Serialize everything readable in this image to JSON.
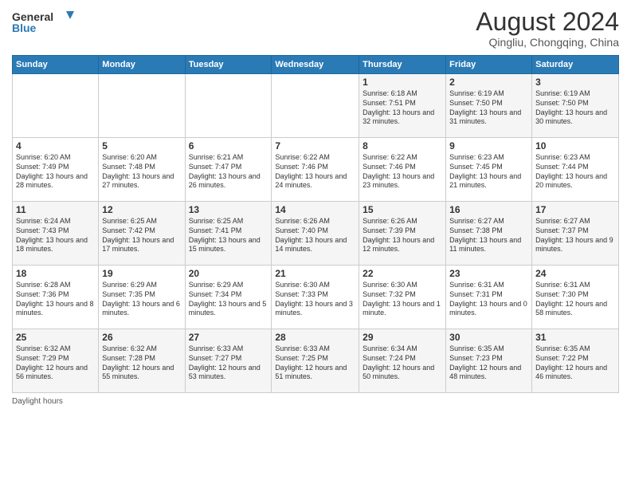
{
  "header": {
    "logo_line1": "General",
    "logo_line2": "Blue",
    "title": "August 2024",
    "subtitle": "Qingliu, Chongqing, China"
  },
  "weekdays": [
    "Sunday",
    "Monday",
    "Tuesday",
    "Wednesday",
    "Thursday",
    "Friday",
    "Saturday"
  ],
  "footer_label": "Daylight hours",
  "weeks": [
    {
      "days": [
        {
          "num": "",
          "info": ""
        },
        {
          "num": "",
          "info": ""
        },
        {
          "num": "",
          "info": ""
        },
        {
          "num": "",
          "info": ""
        },
        {
          "num": "1",
          "info": "Sunrise: 6:18 AM\nSunset: 7:51 PM\nDaylight: 13 hours and 32 minutes."
        },
        {
          "num": "2",
          "info": "Sunrise: 6:19 AM\nSunset: 7:50 PM\nDaylight: 13 hours and 31 minutes."
        },
        {
          "num": "3",
          "info": "Sunrise: 6:19 AM\nSunset: 7:50 PM\nDaylight: 13 hours and 30 minutes."
        }
      ]
    },
    {
      "days": [
        {
          "num": "4",
          "info": "Sunrise: 6:20 AM\nSunset: 7:49 PM\nDaylight: 13 hours and 28 minutes."
        },
        {
          "num": "5",
          "info": "Sunrise: 6:20 AM\nSunset: 7:48 PM\nDaylight: 13 hours and 27 minutes."
        },
        {
          "num": "6",
          "info": "Sunrise: 6:21 AM\nSunset: 7:47 PM\nDaylight: 13 hours and 26 minutes."
        },
        {
          "num": "7",
          "info": "Sunrise: 6:22 AM\nSunset: 7:46 PM\nDaylight: 13 hours and 24 minutes."
        },
        {
          "num": "8",
          "info": "Sunrise: 6:22 AM\nSunset: 7:46 PM\nDaylight: 13 hours and 23 minutes."
        },
        {
          "num": "9",
          "info": "Sunrise: 6:23 AM\nSunset: 7:45 PM\nDaylight: 13 hours and 21 minutes."
        },
        {
          "num": "10",
          "info": "Sunrise: 6:23 AM\nSunset: 7:44 PM\nDaylight: 13 hours and 20 minutes."
        }
      ]
    },
    {
      "days": [
        {
          "num": "11",
          "info": "Sunrise: 6:24 AM\nSunset: 7:43 PM\nDaylight: 13 hours and 18 minutes."
        },
        {
          "num": "12",
          "info": "Sunrise: 6:25 AM\nSunset: 7:42 PM\nDaylight: 13 hours and 17 minutes."
        },
        {
          "num": "13",
          "info": "Sunrise: 6:25 AM\nSunset: 7:41 PM\nDaylight: 13 hours and 15 minutes."
        },
        {
          "num": "14",
          "info": "Sunrise: 6:26 AM\nSunset: 7:40 PM\nDaylight: 13 hours and 14 minutes."
        },
        {
          "num": "15",
          "info": "Sunrise: 6:26 AM\nSunset: 7:39 PM\nDaylight: 13 hours and 12 minutes."
        },
        {
          "num": "16",
          "info": "Sunrise: 6:27 AM\nSunset: 7:38 PM\nDaylight: 13 hours and 11 minutes."
        },
        {
          "num": "17",
          "info": "Sunrise: 6:27 AM\nSunset: 7:37 PM\nDaylight: 13 hours and 9 minutes."
        }
      ]
    },
    {
      "days": [
        {
          "num": "18",
          "info": "Sunrise: 6:28 AM\nSunset: 7:36 PM\nDaylight: 13 hours and 8 minutes."
        },
        {
          "num": "19",
          "info": "Sunrise: 6:29 AM\nSunset: 7:35 PM\nDaylight: 13 hours and 6 minutes."
        },
        {
          "num": "20",
          "info": "Sunrise: 6:29 AM\nSunset: 7:34 PM\nDaylight: 13 hours and 5 minutes."
        },
        {
          "num": "21",
          "info": "Sunrise: 6:30 AM\nSunset: 7:33 PM\nDaylight: 13 hours and 3 minutes."
        },
        {
          "num": "22",
          "info": "Sunrise: 6:30 AM\nSunset: 7:32 PM\nDaylight: 13 hours and 1 minute."
        },
        {
          "num": "23",
          "info": "Sunrise: 6:31 AM\nSunset: 7:31 PM\nDaylight: 13 hours and 0 minutes."
        },
        {
          "num": "24",
          "info": "Sunrise: 6:31 AM\nSunset: 7:30 PM\nDaylight: 12 hours and 58 minutes."
        }
      ]
    },
    {
      "days": [
        {
          "num": "25",
          "info": "Sunrise: 6:32 AM\nSunset: 7:29 PM\nDaylight: 12 hours and 56 minutes."
        },
        {
          "num": "26",
          "info": "Sunrise: 6:32 AM\nSunset: 7:28 PM\nDaylight: 12 hours and 55 minutes."
        },
        {
          "num": "27",
          "info": "Sunrise: 6:33 AM\nSunset: 7:27 PM\nDaylight: 12 hours and 53 minutes."
        },
        {
          "num": "28",
          "info": "Sunrise: 6:33 AM\nSunset: 7:25 PM\nDaylight: 12 hours and 51 minutes."
        },
        {
          "num": "29",
          "info": "Sunrise: 6:34 AM\nSunset: 7:24 PM\nDaylight: 12 hours and 50 minutes."
        },
        {
          "num": "30",
          "info": "Sunrise: 6:35 AM\nSunset: 7:23 PM\nDaylight: 12 hours and 48 minutes."
        },
        {
          "num": "31",
          "info": "Sunrise: 6:35 AM\nSunset: 7:22 PM\nDaylight: 12 hours and 46 minutes."
        }
      ]
    }
  ]
}
